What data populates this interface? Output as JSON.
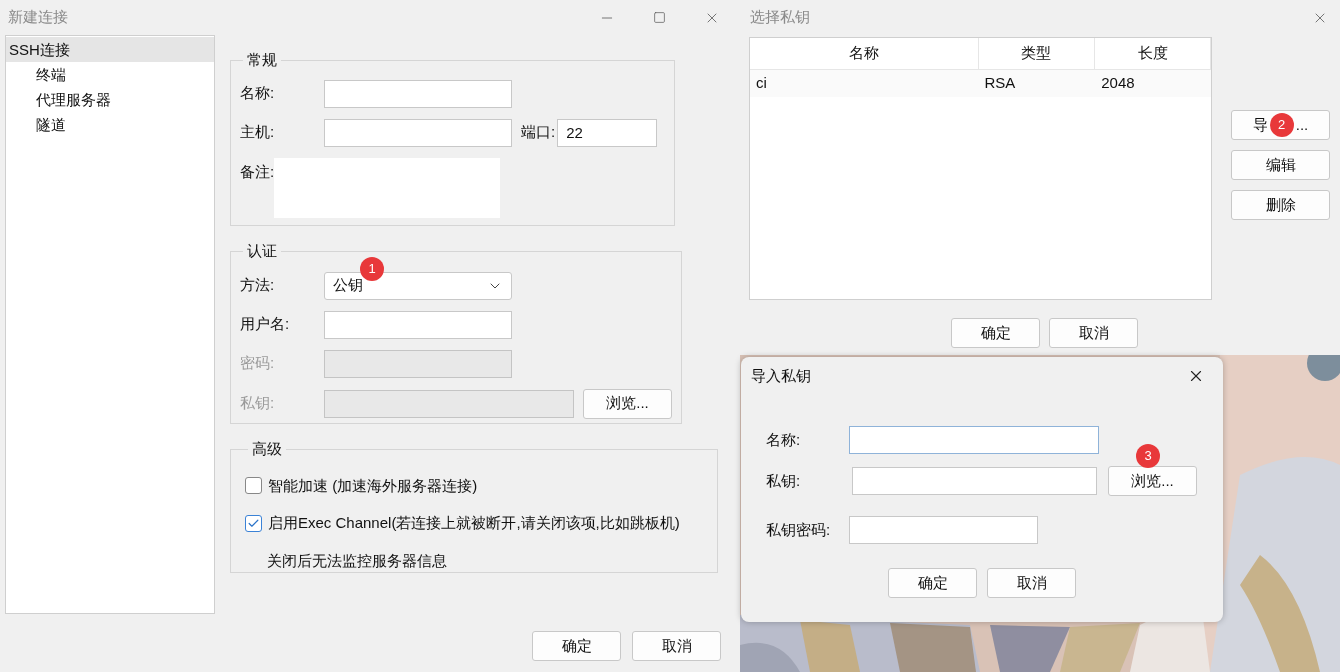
{
  "connection_dialog": {
    "title": "新建连接",
    "tree": [
      {
        "label": "SSH连接",
        "selected": true,
        "children": [
          {
            "label": "终端",
            "selected": false
          },
          {
            "label": "代理服务器",
            "selected": false
          },
          {
            "label": "隧道",
            "selected": false
          }
        ]
      }
    ],
    "general": {
      "legend": "常规",
      "fields": [
        {
          "kind": "text",
          "label": "名称:"
        },
        {
          "kind": "host",
          "label": "主机:",
          "port_label": "端口:",
          "port_value": "22"
        },
        {
          "kind": "memo",
          "label": "备注:"
        }
      ]
    },
    "auth": {
      "legend": "认证",
      "fields": [
        {
          "kind": "select",
          "label": "方法:",
          "value": "公钥",
          "badge": "1",
          "disabled": false
        },
        {
          "kind": "text",
          "label": "用户名:",
          "disabled": false
        },
        {
          "kind": "text",
          "label": "密码:",
          "disabled": true
        },
        {
          "kind": "file",
          "label": "私钥:",
          "disabled": true,
          "button": "浏览..."
        }
      ]
    },
    "advanced": {
      "legend": "高级",
      "options": [
        {
          "label": "智能加速 (加速海外服务器连接)",
          "checked": false
        },
        {
          "label": "启用Exec Channel(若连接上就被断开,请关闭该项,比如跳板机)",
          "checked": true
        }
      ],
      "note": "关闭后无法监控服务器信息"
    },
    "buttons": [
      "确定",
      "取消"
    ]
  },
  "key_dialog": {
    "title": "选择私钥",
    "table": {
      "columns": [
        "名称",
        "类型",
        "长度"
      ],
      "rows": [
        [
          "ci",
          "RSA",
          "2048"
        ]
      ]
    },
    "side_buttons": [
      {
        "label_start": "导",
        "label_end": "...",
        "badge": "2"
      },
      {
        "label_start": "编辑"
      },
      {
        "label_start": "删除"
      }
    ],
    "buttons": [
      "确定",
      "取消"
    ]
  },
  "import_dialog": {
    "title": "导入私钥",
    "fields": [
      {
        "kind": "text",
        "label": "名称:",
        "focused": true
      },
      {
        "kind": "file",
        "label": "私钥:",
        "focused": false,
        "button": "浏览...",
        "badge": "3"
      },
      {
        "kind": "password",
        "label": "私钥密码:",
        "focused": false
      }
    ],
    "buttons": [
      "确定",
      "取消"
    ]
  }
}
